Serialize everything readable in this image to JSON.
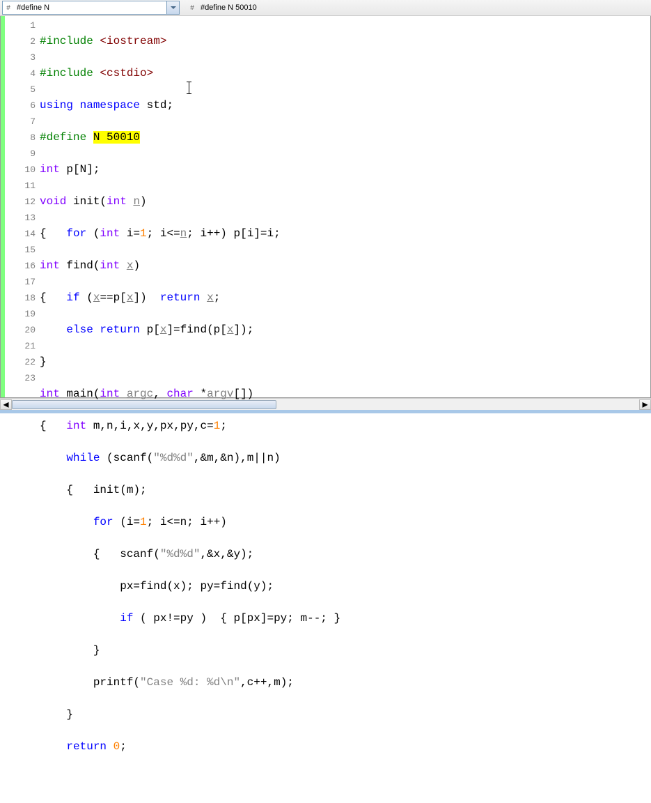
{
  "toolbar": {
    "field1_icon": "#",
    "field1_text": "#define N",
    "field2_icon": "#",
    "field2_text": "#define N 50010"
  },
  "gutter": [
    "1",
    "2",
    "3",
    "4",
    "5",
    "6",
    "7",
    "8",
    "9",
    "10",
    "11",
    "12",
    "13",
    "14",
    "15",
    "16",
    "17",
    "18",
    "19",
    "20",
    "21",
    "22",
    "23"
  ],
  "code": {
    "l1": {
      "pre": "#include ",
      "inc": "<iostream>"
    },
    "l2": {
      "pre": "#include ",
      "inc": "<cstdio>"
    },
    "l3": {
      "kw": "using ",
      "ns1": "namespace ",
      "ns2": "std",
      "semi": ";"
    },
    "l4": {
      "pre": "#define ",
      "hl": "N 50010"
    },
    "l5": {
      "type": "int ",
      "txt": "p",
      "br": "[N];"
    },
    "l6": {
      "type": "void ",
      "fn": "init",
      "op": "(",
      "type2": "int ",
      "arg": "n",
      "cl": ")"
    },
    "l7": {
      "br": "{   ",
      "kw": "for ",
      "op": "(",
      "type": "int ",
      "txt": "i",
      "eq": "=",
      "num": "1",
      "sc": "; i",
      "le": "<=",
      "n": "n",
      "sc2": "; i",
      "pp": "++) ",
      "arr": "p",
      "br2": "[",
      "i": "i",
      "br3": "]=",
      "i2": "i",
      "semi": ";"
    },
    "l8": {
      "type": "int ",
      "fn": "find",
      "op": "(",
      "type2": "int ",
      "arg": "x",
      "cl": ")"
    },
    "l9": {
      "br": "{   ",
      "kw": "if ",
      "op": "(",
      "x": "x",
      "eq": "==",
      "p": "p",
      "br2": "[",
      "x2": "x",
      "br3": "])  ",
      "ret": "return ",
      "x3": "x",
      "semi": ";"
    },
    "l10": {
      "sp": "    ",
      "kw": "else return ",
      "p": "p",
      "br": "[",
      "x": "x",
      "br2": "]=",
      "fn": "find",
      "op": "(",
      "p2": "p",
      "br3": "[",
      "x2": "x",
      "br4": "]);"
    },
    "l11": {
      "br": "}"
    },
    "l12": {
      "type": "int ",
      "fn": "main",
      "op": "(",
      "type2": "int ",
      "argc": "argc",
      "c": ", ",
      "type3": "char ",
      "star": "*",
      "argv": "argv",
      "br": "[])"
    },
    "l13": {
      "br": "{   ",
      "type": "int ",
      "txt": "m",
      "c": ",",
      "n": "n",
      "c2": ",",
      "i": "i",
      "c3": ",",
      "x": "x",
      "c4": ",",
      "y": "y",
      "c5": ",",
      "px": "px",
      "c6": ",",
      "py": "py",
      "c7": ",",
      "cv": "c",
      "eq": "=",
      "num": "1",
      "semi": ";"
    },
    "l14": {
      "sp": "    ",
      "kw": "while ",
      "op": "(",
      "fn": "scanf",
      "op2": "(",
      "str": "\"%d%d\"",
      "c": ",&",
      "m": "m",
      "c2": ",&",
      "n": "n",
      "cl": "),",
      "m2": "m",
      "or": "||",
      "n2": "n",
      "cl2": ")"
    },
    "l15": {
      "sp": "    {   ",
      "fn": "init",
      "op": "(",
      "m": "m",
      "cl": ");"
    },
    "l16": {
      "sp": "        ",
      "kw": "for ",
      "op": "(",
      "i": "i",
      "eq": "=",
      "num": "1",
      "sc": "; i",
      "le": "<=",
      "n": "n",
      "sc2": "; i",
      "pp": "++)"
    },
    "l17": {
      "sp": "        {   ",
      "fn": "scanf",
      "op": "(",
      "str": "\"%d%d\"",
      "c": ",&",
      "x": "x",
      "c2": ",&",
      "y": "y",
      "cl": ");"
    },
    "l18": {
      "sp": "            ",
      "px": "px",
      "eq": "=",
      "fn": "find",
      "op": "(",
      "x": "x",
      "cl": "); ",
      "py": "py",
      "eq2": "=",
      "fn2": "find",
      "op2": "(",
      "y": "y",
      "cl2": ");"
    },
    "l19": {
      "sp": "            ",
      "kw": "if ",
      "op": "( ",
      "px": "px",
      "ne": "!=",
      "py": "py",
      "cl": " )  { ",
      "p": "p",
      "br": "[",
      "px2": "px",
      "br2": "]=",
      "py2": "py",
      "sc": "; ",
      "m": "m",
      "mm": "--; }"
    },
    "l20": {
      "sp": "        }",
      "": ""
    },
    "l21": {
      "sp": "        ",
      "fn": "printf",
      "op": "(",
      "str": "\"Case %d: %d\\n\"",
      "c": ",",
      "cv": "c",
      "pp": "++,",
      "m": "m",
      "cl": ");"
    },
    "l22": {
      "sp": "    }",
      "": ""
    },
    "l23": {
      "sp": "    ",
      "kw": "return ",
      "num": "0",
      "semi": ";"
    }
  }
}
